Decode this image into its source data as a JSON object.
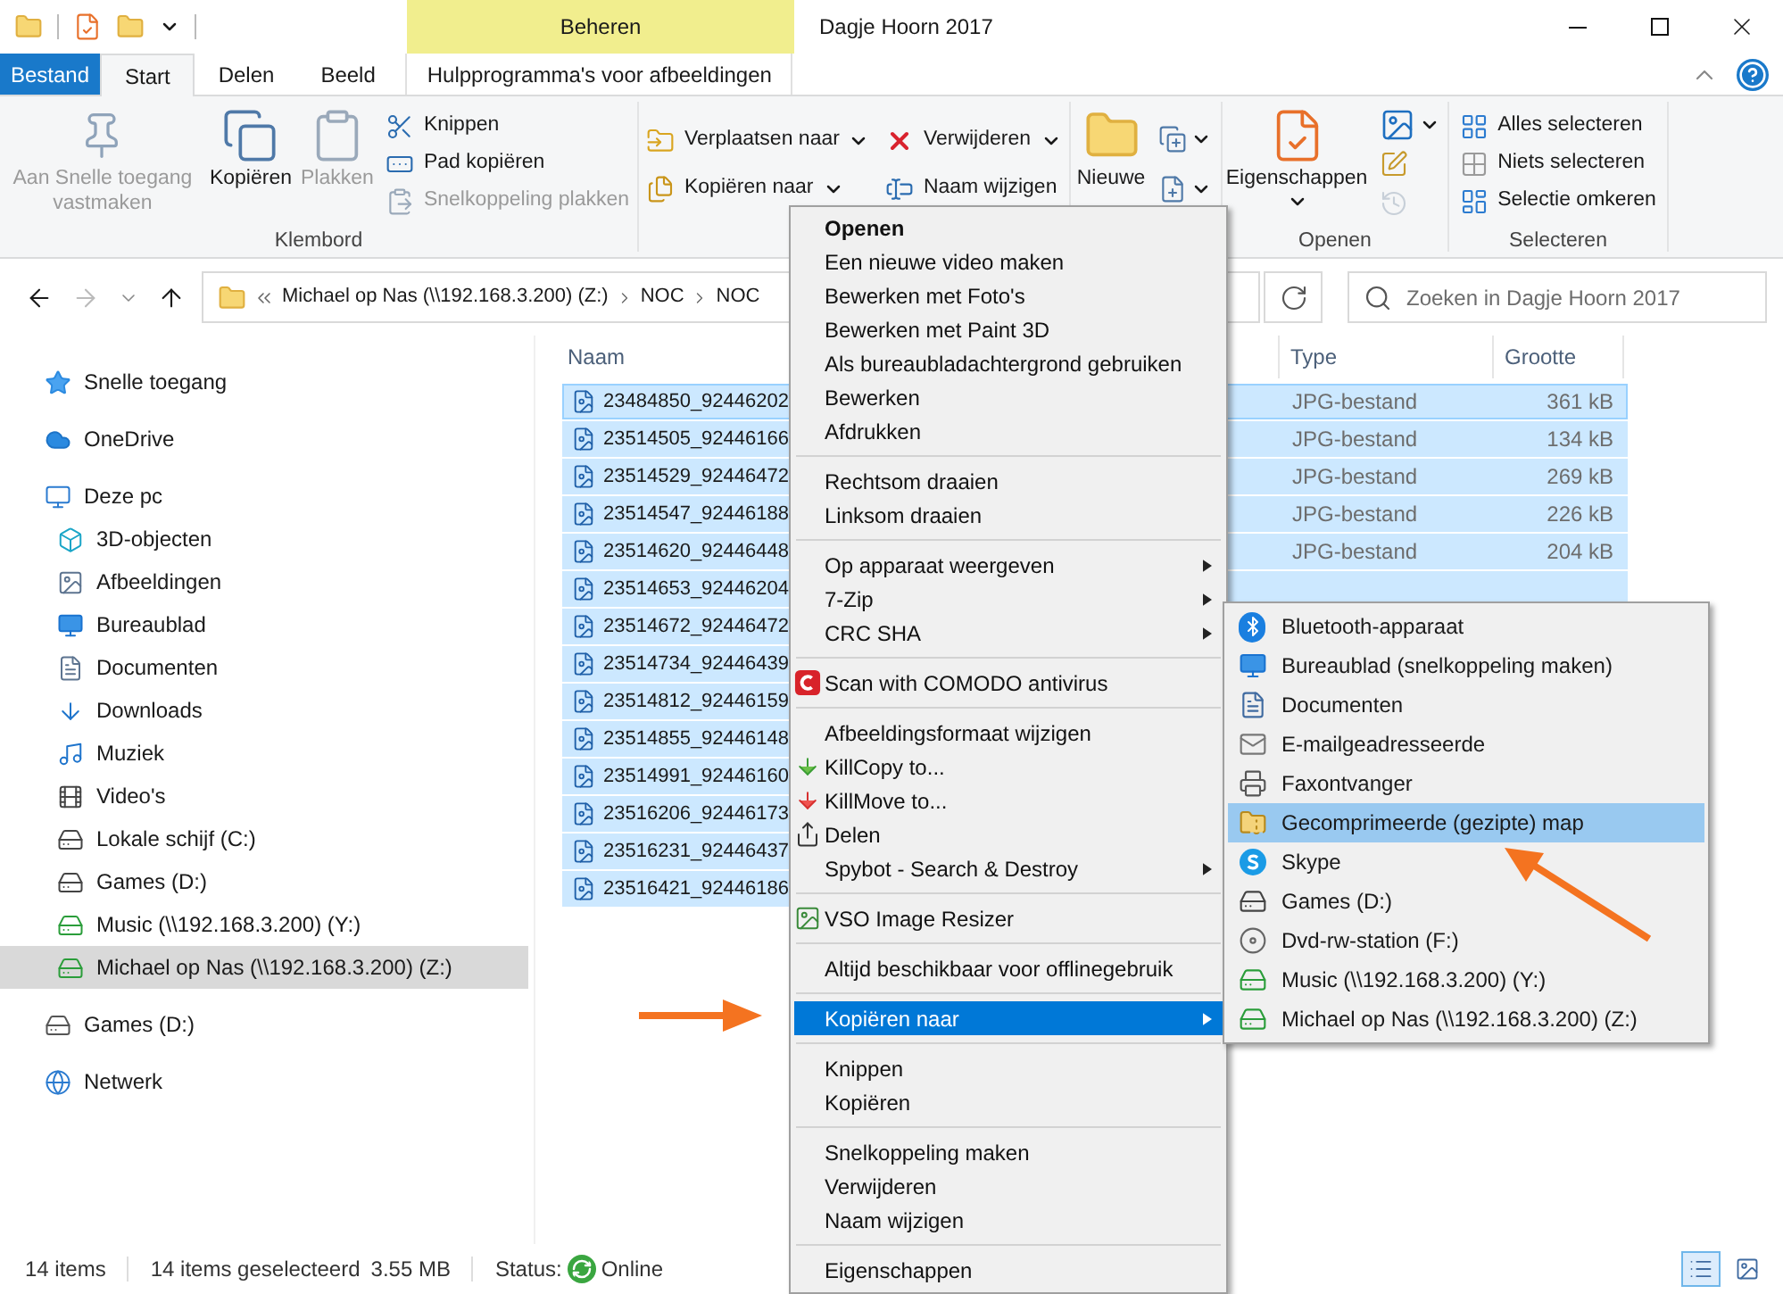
{
  "window": {
    "title": "Dagje Hoorn 2017",
    "contextual_header": "Beheren"
  },
  "tabs": [
    {
      "label": "Bestand",
      "kind": "file",
      "selected": false
    },
    {
      "label": "Start",
      "kind": "tab",
      "selected": true
    },
    {
      "label": "Delen",
      "kind": "tab",
      "selected": false
    },
    {
      "label": "Beeld",
      "kind": "tab",
      "selected": false
    },
    {
      "label": "Hulpprogramma's voor afbeeldingen",
      "kind": "contextual",
      "selected": false
    }
  ],
  "ribbon": {
    "groups": [
      {
        "label": "Klembord",
        "columns": [
          [
            {
              "kind": "large",
              "label": "Aan Snelle toegang vastmaken",
              "disabled": true,
              "dropdown": false
            }
          ],
          [
            {
              "kind": "large",
              "label": "Kopiëren",
              "disabled": false,
              "dropdown": false
            }
          ],
          [
            {
              "kind": "large",
              "label": "Plakken",
              "disabled": true,
              "dropdown": false
            }
          ],
          [
            {
              "kind": "small",
              "label": "Knippen",
              "disabled": false,
              "dropdown": false
            },
            {
              "kind": "small",
              "label": "Pad kopiëren",
              "disabled": false,
              "dropdown": false
            },
            {
              "kind": "small",
              "label": "Snelkoppeling plakken",
              "disabled": true,
              "dropdown": false
            }
          ]
        ]
      },
      {
        "columns": [
          [
            {
              "kind": "small",
              "label": "Verplaatsen naar",
              "disabled": false,
              "dropdown": true
            },
            {
              "kind": "small",
              "label": "Kopiëren naar",
              "disabled": false,
              "dropdown": true
            }
          ],
          [
            {
              "kind": "small",
              "label": "Verwijderen",
              "disabled": false,
              "dropdown": true
            },
            {
              "kind": "small",
              "label": "Naam wijzigen",
              "disabled": false,
              "dropdown": false
            }
          ]
        ]
      },
      {
        "columns": [
          [
            {
              "kind": "large",
              "label": "Nieuwe",
              "disabled": false,
              "dropdown": false
            }
          ],
          [
            {
              "kind": "icon",
              "disabled": false,
              "dropdown": true
            },
            {
              "kind": "icon",
              "disabled": false,
              "dropdown": true
            }
          ]
        ]
      },
      {
        "label": "Openen",
        "columns": [
          [
            {
              "kind": "large",
              "label": "Eigenschappen",
              "disabled": false,
              "dropdown": true
            }
          ],
          [
            {
              "kind": "icon",
              "disabled": false,
              "dropdown": true
            },
            {
              "kind": "icon",
              "disabled": false,
              "dropdown": false
            },
            {
              "kind": "icon",
              "disabled": true,
              "dropdown": false
            }
          ]
        ]
      },
      {
        "label": "Selecteren",
        "columns": [
          [
            {
              "kind": "small",
              "label": "Alles selecteren",
              "disabled": false,
              "dropdown": false
            },
            {
              "kind": "small",
              "label": "Niets selecteren",
              "disabled": false,
              "dropdown": false
            },
            {
              "kind": "small",
              "label": "Selectie omkeren",
              "disabled": false,
              "dropdown": false
            }
          ]
        ]
      }
    ]
  },
  "address_bar": {
    "segments": [
      "Michael op Nas (\\\\192.168.3.200) (Z:)",
      "NOC",
      "NOC"
    ]
  },
  "search": {
    "placeholder": "Zoeken in Dagje Hoorn 2017"
  },
  "navigation": {
    "items": [
      {
        "label": "Snelle toegang",
        "selected": false
      },
      {
        "label": "OneDrive",
        "selected": false
      },
      {
        "label": "Deze pc",
        "selected": false,
        "children": [
          {
            "label": "3D-objecten",
            "selected": false
          },
          {
            "label": "Afbeeldingen",
            "selected": false
          },
          {
            "label": "Bureaublad",
            "selected": false
          },
          {
            "label": "Documenten",
            "selected": false
          },
          {
            "label": "Downloads",
            "selected": false
          },
          {
            "label": "Muziek",
            "selected": false
          },
          {
            "label": "Video's",
            "selected": false
          },
          {
            "label": "Lokale schijf (C:)",
            "selected": false
          },
          {
            "label": "Games (D:)",
            "selected": false
          },
          {
            "label": "Music (\\\\192.168.3.200) (Y:)",
            "selected": false
          },
          {
            "label": "Michael op Nas (\\\\192.168.3.200) (Z:)",
            "selected": true
          }
        ]
      },
      {
        "label": "Games (D:)",
        "selected": false
      },
      {
        "label": "Netwerk",
        "selected": false
      }
    ]
  },
  "file_list": {
    "columns": [
      "Naam",
      "Type",
      "Grootte"
    ],
    "rows": [
      {
        "name": "23484850_92446202",
        "type": "JPG-bestand",
        "size": "361 kB",
        "selected": true
      },
      {
        "name": "23514505_92446166",
        "type": "JPG-bestand",
        "size": "134 kB",
        "selected": true
      },
      {
        "name": "23514529_92446472",
        "type": "JPG-bestand",
        "size": "269 kB",
        "selected": true
      },
      {
        "name": "23514547_92446188",
        "type": "JPG-bestand",
        "size": "226 kB",
        "selected": true
      },
      {
        "name": "23514620_92446448",
        "type": "JPG-bestand",
        "size": "204 kB",
        "selected": true
      },
      {
        "name": "23514653_92446204",
        "selected": true
      },
      {
        "name": "23514672_92446472",
        "selected": true
      },
      {
        "name": "23514734_92446439",
        "selected": true
      },
      {
        "name": "23514812_92446159",
        "selected": true
      },
      {
        "name": "23514855_92446148",
        "selected": true
      },
      {
        "name": "23514991_92446160",
        "selected": true
      },
      {
        "name": "23516206_92446173",
        "selected": true
      },
      {
        "name": "23516231_92446437",
        "selected": true
      },
      {
        "name": "23516421_92446186",
        "selected": true
      }
    ]
  },
  "context_menu": {
    "groups": [
      [
        {
          "label": "Openen",
          "kind": "default",
          "submenu": false,
          "selected": false
        },
        {
          "label": "Een nieuwe video maken",
          "kind": "command",
          "submenu": false,
          "selected": false
        },
        {
          "label": "Bewerken met Foto's",
          "kind": "command",
          "submenu": false,
          "selected": false
        },
        {
          "label": "Bewerken met Paint 3D",
          "kind": "command",
          "submenu": false,
          "selected": false
        },
        {
          "label": "Als bureaubladachtergrond gebruiken",
          "kind": "command",
          "submenu": false,
          "selected": false
        },
        {
          "label": "Bewerken",
          "kind": "command",
          "submenu": false,
          "selected": false
        },
        {
          "label": "Afdrukken",
          "kind": "command",
          "submenu": false,
          "selected": false
        }
      ],
      [
        {
          "label": "Rechtsom draaien",
          "kind": "command",
          "submenu": false,
          "selected": false
        },
        {
          "label": "Linksom draaien",
          "kind": "command",
          "submenu": false,
          "selected": false
        }
      ],
      [
        {
          "label": "Op apparaat weergeven",
          "kind": "command",
          "submenu": true,
          "selected": false
        },
        {
          "label": "7-Zip",
          "kind": "command",
          "submenu": true,
          "selected": false
        },
        {
          "label": "CRC SHA",
          "kind": "command",
          "submenu": true,
          "selected": false
        }
      ],
      [
        {
          "label": "Scan with COMODO antivirus",
          "kind": "command",
          "submenu": false,
          "selected": false
        }
      ],
      [
        {
          "label": "Afbeeldingsformaat wijzigen",
          "kind": "command",
          "submenu": false,
          "selected": false
        },
        {
          "label": "KillCopy to...",
          "kind": "command",
          "submenu": false,
          "selected": false
        },
        {
          "label": "KillMove to...",
          "kind": "command",
          "submenu": false,
          "selected": false
        },
        {
          "label": "Delen",
          "kind": "command",
          "submenu": false,
          "selected": false
        },
        {
          "label": "Spybot - Search & Destroy",
          "kind": "command",
          "submenu": true,
          "selected": false
        }
      ],
      [
        {
          "label": "VSO Image Resizer",
          "kind": "command",
          "submenu": false,
          "selected": false
        }
      ],
      [
        {
          "label": "Altijd beschikbaar voor offlinegebruik",
          "kind": "command",
          "submenu": false,
          "selected": false
        }
      ],
      [
        {
          "label": "Kopiëren naar",
          "kind": "command",
          "submenu": true,
          "selected": true
        }
      ],
      [
        {
          "label": "Knippen",
          "kind": "command",
          "submenu": false,
          "selected": false
        },
        {
          "label": "Kopiëren",
          "kind": "command",
          "submenu": false,
          "selected": false
        }
      ],
      [
        {
          "label": "Snelkoppeling maken",
          "kind": "command",
          "submenu": false,
          "selected": false
        },
        {
          "label": "Verwijderen",
          "kind": "command",
          "submenu": false,
          "selected": false
        },
        {
          "label": "Naam wijzigen",
          "kind": "command",
          "submenu": false,
          "selected": false
        }
      ],
      [
        {
          "label": "Eigenschappen",
          "kind": "command",
          "submenu": false,
          "selected": false
        }
      ]
    ]
  },
  "copy_to_submenu": {
    "items": [
      {
        "label": "Bluetooth-apparaat",
        "selected": false
      },
      {
        "label": "Bureaublad (snelkoppeling maken)",
        "selected": false
      },
      {
        "label": "Documenten",
        "selected": false
      },
      {
        "label": "E-mailgeadresseerde",
        "selected": false
      },
      {
        "label": "Faxontvanger",
        "selected": false
      },
      {
        "label": "Gecomprimeerde (gezipte) map",
        "selected": true
      },
      {
        "label": "Skype",
        "selected": false
      },
      {
        "label": "Games (D:)",
        "selected": false
      },
      {
        "label": "Dvd-rw-station (F:)",
        "selected": false
      },
      {
        "label": "Music (\\\\192.168.3.200) (Y:)",
        "selected": false
      },
      {
        "label": "Michael op Nas (\\\\192.168.3.200) (Z:)",
        "selected": false
      }
    ]
  },
  "status_bar": {
    "item_count": "14 items",
    "selection": "14 items geselecteerd",
    "selection_size": "3.55 MB",
    "status_label": "Status:",
    "status": "Online",
    "views": [
      {
        "selected": true
      },
      {
        "selected": false
      }
    ]
  }
}
